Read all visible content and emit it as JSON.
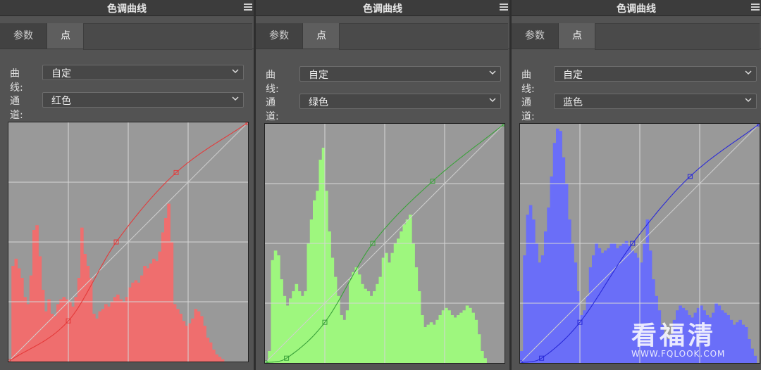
{
  "panels": [
    {
      "title": "色调曲线",
      "tab_params": "参数",
      "tab_points": "点",
      "curve_label": "曲线:",
      "curve_value": "自定",
      "channel_label": "通道:",
      "channel_value": "红色",
      "channel_color": "#ef6e6e",
      "curve_color": "#e43a3a",
      "curve_points": [
        [
          0,
          0
        ],
        [
          0.25,
          0.17
        ],
        [
          0.45,
          0.5
        ],
        [
          0.7,
          0.79
        ],
        [
          1,
          1
        ]
      ],
      "histogram": [
        0,
        0.4,
        0.43,
        0.39,
        0.35,
        0.27,
        0.24,
        0.36,
        0.55,
        0.57,
        0.44,
        0.3,
        0.21,
        0.26,
        0.2,
        0.19,
        0.24,
        0.26,
        0.27,
        0.26,
        0.25,
        0.23,
        0.27,
        0.35,
        0.56,
        0.45,
        0.4,
        0.35,
        0.2,
        0.18,
        0.21,
        0.22,
        0.24,
        0.23,
        0.25,
        0.27,
        0.28,
        0.26,
        0.25,
        0.27,
        0.31,
        0.33,
        0.34,
        0.33,
        0.36,
        0.4,
        0.39,
        0.41,
        0.43,
        0.42,
        0.46,
        0.54,
        0.6,
        0.66,
        0.5,
        0.24,
        0.22,
        0.2,
        0.17,
        0.15,
        0.16,
        0.18,
        0.22,
        0.21,
        0.19,
        0.15,
        0.1,
        0.08,
        0.05,
        0.03,
        0.02,
        0.01,
        0,
        0,
        0,
        0,
        0,
        0,
        0,
        0
      ]
    },
    {
      "title": "色调曲线",
      "tab_params": "参数",
      "tab_points": "点",
      "curve_label": "曲线:",
      "curve_value": "自定",
      "channel_label": "通道:",
      "channel_value": "绿色",
      "channel_color": "#9ef77e",
      "curve_color": "#3aa23a",
      "curve_points": [
        [
          0,
          0
        ],
        [
          0.09,
          0.02
        ],
        [
          0.25,
          0.17
        ],
        [
          0.45,
          0.5
        ],
        [
          0.7,
          0.76
        ],
        [
          1,
          1
        ]
      ],
      "histogram": [
        0.01,
        0.05,
        0.43,
        0.47,
        0.45,
        0.35,
        0.28,
        0.24,
        0.27,
        0.3,
        0.33,
        0.3,
        0.28,
        0.3,
        0.5,
        0.6,
        0.68,
        0.72,
        0.85,
        0.9,
        0.72,
        0.55,
        0.44,
        0.36,
        0.28,
        0.2,
        0.18,
        0.22,
        0.35,
        0.38,
        0.4,
        0.37,
        0.33,
        0.31,
        0.3,
        0.28,
        0.3,
        0.33,
        0.36,
        0.44,
        0.46,
        0.42,
        0.46,
        0.5,
        0.52,
        0.55,
        0.58,
        0.6,
        0.62,
        0.5,
        0.4,
        0.3,
        0.2,
        0.15,
        0.16,
        0.17,
        0.16,
        0.18,
        0.2,
        0.22,
        0.23,
        0.22,
        0.2,
        0.19,
        0.2,
        0.21,
        0.22,
        0.24,
        0.23,
        0.21,
        0.18,
        0.12,
        0.05,
        0.02,
        0,
        0,
        0,
        0,
        0,
        0
      ]
    },
    {
      "title": "色调曲线",
      "tab_params": "参数",
      "tab_points": "点",
      "curve_label": "曲线:",
      "curve_value": "自定",
      "channel_label": "通道:",
      "channel_value": "蓝色",
      "channel_color": "#6a6ef8",
      "curve_color": "#2a2ad8",
      "curve_points": [
        [
          0,
          0
        ],
        [
          0.09,
          0.02
        ],
        [
          0.25,
          0.17
        ],
        [
          0.47,
          0.5
        ],
        [
          0.71,
          0.78
        ],
        [
          1,
          1
        ]
      ],
      "histogram": [
        0.05,
        0.45,
        0.62,
        0.66,
        0.6,
        0.5,
        0.42,
        0.45,
        0.55,
        0.65,
        0.78,
        0.92,
        0.98,
        0.97,
        0.86,
        0.75,
        0.6,
        0.5,
        0.42,
        0.3,
        0.2,
        0.22,
        0.28,
        0.4,
        0.45,
        0.5,
        0.48,
        0.46,
        0.47,
        0.48,
        0.5,
        0.5,
        0.48,
        0.49,
        0.5,
        0.51,
        0.49,
        0.47,
        0.46,
        0.44,
        0.42,
        0.5,
        0.6,
        0.47,
        0.35,
        0.28,
        0.22,
        0.16,
        0.12,
        0.1,
        0.12,
        0.18,
        0.22,
        0.24,
        0.23,
        0.22,
        0.2,
        0.19,
        0.21,
        0.23,
        0.24,
        0.22,
        0.2,
        0.19,
        0.21,
        0.25,
        0.24,
        0.22,
        0.21,
        0.2,
        0.18,
        0.16,
        0.17,
        0.18,
        0.16,
        0.15,
        0.1,
        0.06,
        0.03,
        0
      ]
    }
  ],
  "watermark": {
    "main": "看福清",
    "sub": "WWW.FQLOOK.COM"
  }
}
